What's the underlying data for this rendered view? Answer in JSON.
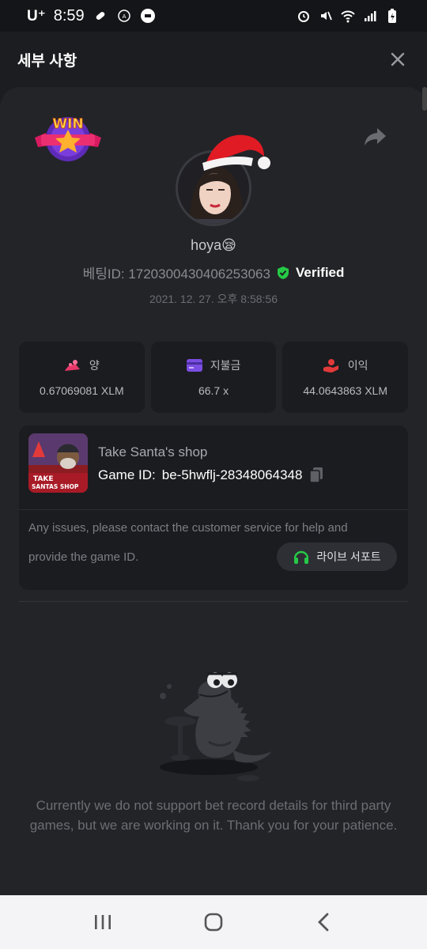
{
  "status_bar": {
    "carrier": "U⁺",
    "time": "8:59"
  },
  "header": {
    "title": "세부 사항"
  },
  "user": {
    "name": "hoya😪",
    "bet_id": "베팅ID: 1720300430406253063",
    "verified": "Verified",
    "datetime": "2021. 12. 27. 오후 8:58:56"
  },
  "stats": [
    {
      "label": "양",
      "value": "0.67069081 XLM",
      "icon": "coins-icon",
      "color": "#e8386a"
    },
    {
      "label": "지불금",
      "value": "66.7 x",
      "icon": "wallet-card-icon",
      "color": "#7b4de2"
    },
    {
      "label": "이익",
      "value": "44.0643863 XLM",
      "icon": "hand-coins-icon",
      "color": "#e23a3a"
    }
  ],
  "game": {
    "name": "Take Santa's shop",
    "id_label": "Game ID:",
    "id_value": "be-5hwflj-28348064348",
    "thumb_text": "TAKE SANTAS SHOP",
    "help_line1": "Any issues, please contact the customer service for help and",
    "help_line2": "provide the game ID.",
    "live_support": "라이브 서포트"
  },
  "empty_state": {
    "message": "Currently we do not support bet record details for third party games, but we are working on it. Thank you for your patience."
  },
  "colors": {
    "accent_green": "#26c946",
    "panel": "#232428",
    "card": "#1b1c20"
  }
}
